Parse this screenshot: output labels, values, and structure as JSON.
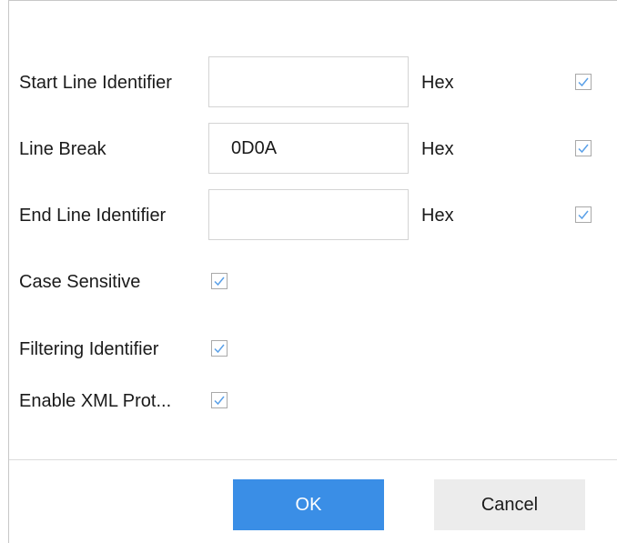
{
  "fields": {
    "start_line_identifier": {
      "label": "Start Line Identifier",
      "value": "",
      "unit": "Hex",
      "checked": true
    },
    "line_break": {
      "label": "Line Break",
      "value": "0D0A",
      "unit": "Hex",
      "checked": true
    },
    "end_line_identifier": {
      "label": "End Line Identifier",
      "value": "",
      "unit": "Hex",
      "checked": true
    }
  },
  "options": {
    "case_sensitive": {
      "label": "Case Sensitive",
      "checked": true
    },
    "filtering_identifier": {
      "label": "Filtering Identifier",
      "checked": true
    },
    "enable_xml_protocol": {
      "label": "Enable XML Prot...",
      "checked": true
    }
  },
  "buttons": {
    "ok": "OK",
    "cancel": "Cancel"
  },
  "colors": {
    "primary": "#3a8ee6",
    "check": "#5aa0e8",
    "secondary_button": "#ececec"
  }
}
